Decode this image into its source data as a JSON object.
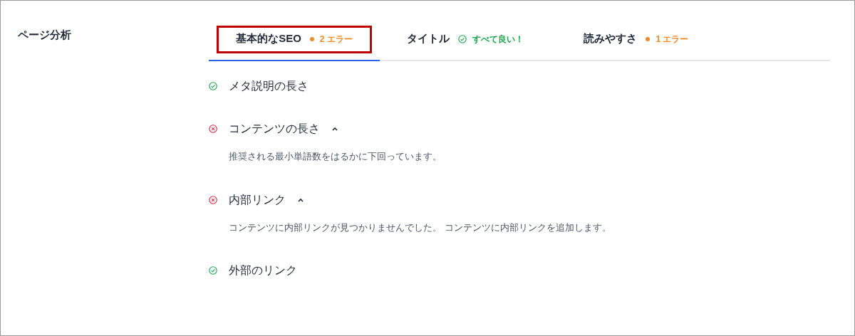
{
  "section_label": "ページ分析",
  "tabs": [
    {
      "label": "基本的なSEO",
      "kind": "error",
      "status_text": "2 エラー",
      "selected": true,
      "highlighted": true
    },
    {
      "label": "タイトル",
      "kind": "ok",
      "status_text": "すべて良い！",
      "selected": false,
      "highlighted": false
    },
    {
      "label": "読みやすさ",
      "kind": "error",
      "status_text": "1 エラー",
      "selected": false,
      "highlighted": false
    }
  ],
  "checks": [
    {
      "label": "メタ説明の長さ",
      "kind": "pass"
    },
    {
      "label": "コンテンツの長さ",
      "kind": "fail",
      "expanded": true,
      "description": "推奨される最小単語数をはるかに下回っています。"
    },
    {
      "label": "内部リンク",
      "kind": "fail",
      "expanded": true,
      "description": "コンテンツに内部リンクが見つかりませんでした。 コンテンツに内部リンクを追加します。"
    },
    {
      "label": "外部のリンク",
      "kind": "pass"
    }
  ]
}
